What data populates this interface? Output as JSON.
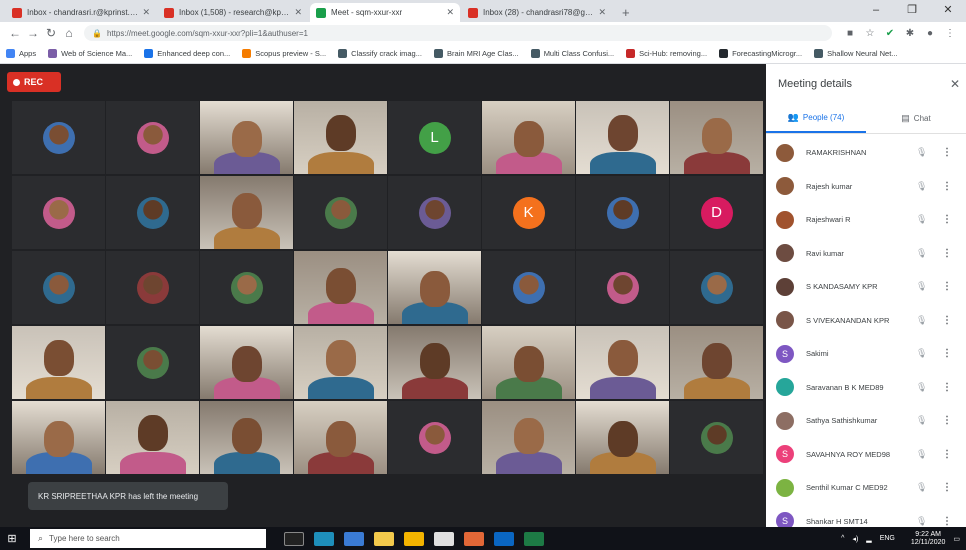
{
  "browser": {
    "tabs": [
      {
        "title": "Inbox - chandrasri.r@kprinst.ac.in",
        "fav": "#d93025"
      },
      {
        "title": "Inbox (1,508) - research@kprinst...",
        "fav": "#d93025"
      },
      {
        "title": "Meet - sqm-xxur-xxr",
        "fav": "#1a9f4b"
      },
      {
        "title": "Inbox (28) - chandrasri78@gmail...",
        "fav": "#d93025"
      }
    ],
    "url": "https://meet.google.com/sqm-xxur-xxr?pli=1&authuser=1",
    "bookmarks": [
      {
        "label": "Apps",
        "color": "#4285f4"
      },
      {
        "label": "Web of Science Ma...",
        "color": "#7b5ea7"
      },
      {
        "label": "Enhanced deep con...",
        "color": "#1a73e8"
      },
      {
        "label": "Scopus preview - S...",
        "color": "#f57c00"
      },
      {
        "label": "Classify crack imag...",
        "color": "#455a64"
      },
      {
        "label": "Brain MRI Age Clas...",
        "color": "#455a64"
      },
      {
        "label": "Multi Class Confusi...",
        "color": "#455a64"
      },
      {
        "label": "Sci-Hub: removing...",
        "color": "#c62828"
      },
      {
        "label": "ForecastingMicrogr...",
        "color": "#24292e"
      },
      {
        "label": "Shallow Neural Net...",
        "color": "#455a64"
      }
    ]
  },
  "meet": {
    "rec_label": "REC",
    "toast": "KR SRIPREETHAA KPR has left the meeting",
    "panel_title": "Meeting details",
    "people_tab": "People (74)",
    "chat_tab": "Chat",
    "participants": [
      {
        "name": "RAMAKRISHNAN",
        "color": "#8d5a3b",
        "letter": ""
      },
      {
        "name": "Rajesh kumar",
        "color": "#8d5a3b",
        "letter": ""
      },
      {
        "name": "Rajeshwari R",
        "color": "#a0522d",
        "letter": ""
      },
      {
        "name": "Ravi kumar",
        "color": "#6d4c41",
        "letter": ""
      },
      {
        "name": "S KANDASAMY KPR",
        "color": "#5d4037",
        "letter": ""
      },
      {
        "name": "S VIVEKANANDAN KPR",
        "color": "#795548",
        "letter": ""
      },
      {
        "name": "Sakimi",
        "color": "#7e57c2",
        "letter": "S"
      },
      {
        "name": "Saravanan B K MED89",
        "color": "#26a69a",
        "letter": ""
      },
      {
        "name": "Sathya Sathishkumar",
        "color": "#8d6e63",
        "letter": ""
      },
      {
        "name": "SAVAHNYA ROY MED98",
        "color": "#ec407a",
        "letter": "S"
      },
      {
        "name": "Senthil Kumar C MED92",
        "color": "#7cb342",
        "letter": ""
      },
      {
        "name": "Shankar H SMT14",
        "color": "#7e57c2",
        "letter": "S"
      }
    ],
    "tile_letters": [
      "L",
      "K",
      "D"
    ]
  },
  "taskbar": {
    "search_placeholder": "Type here to search",
    "lang": "ENG",
    "time": "9:22 AM",
    "date": "12/11/2020"
  }
}
